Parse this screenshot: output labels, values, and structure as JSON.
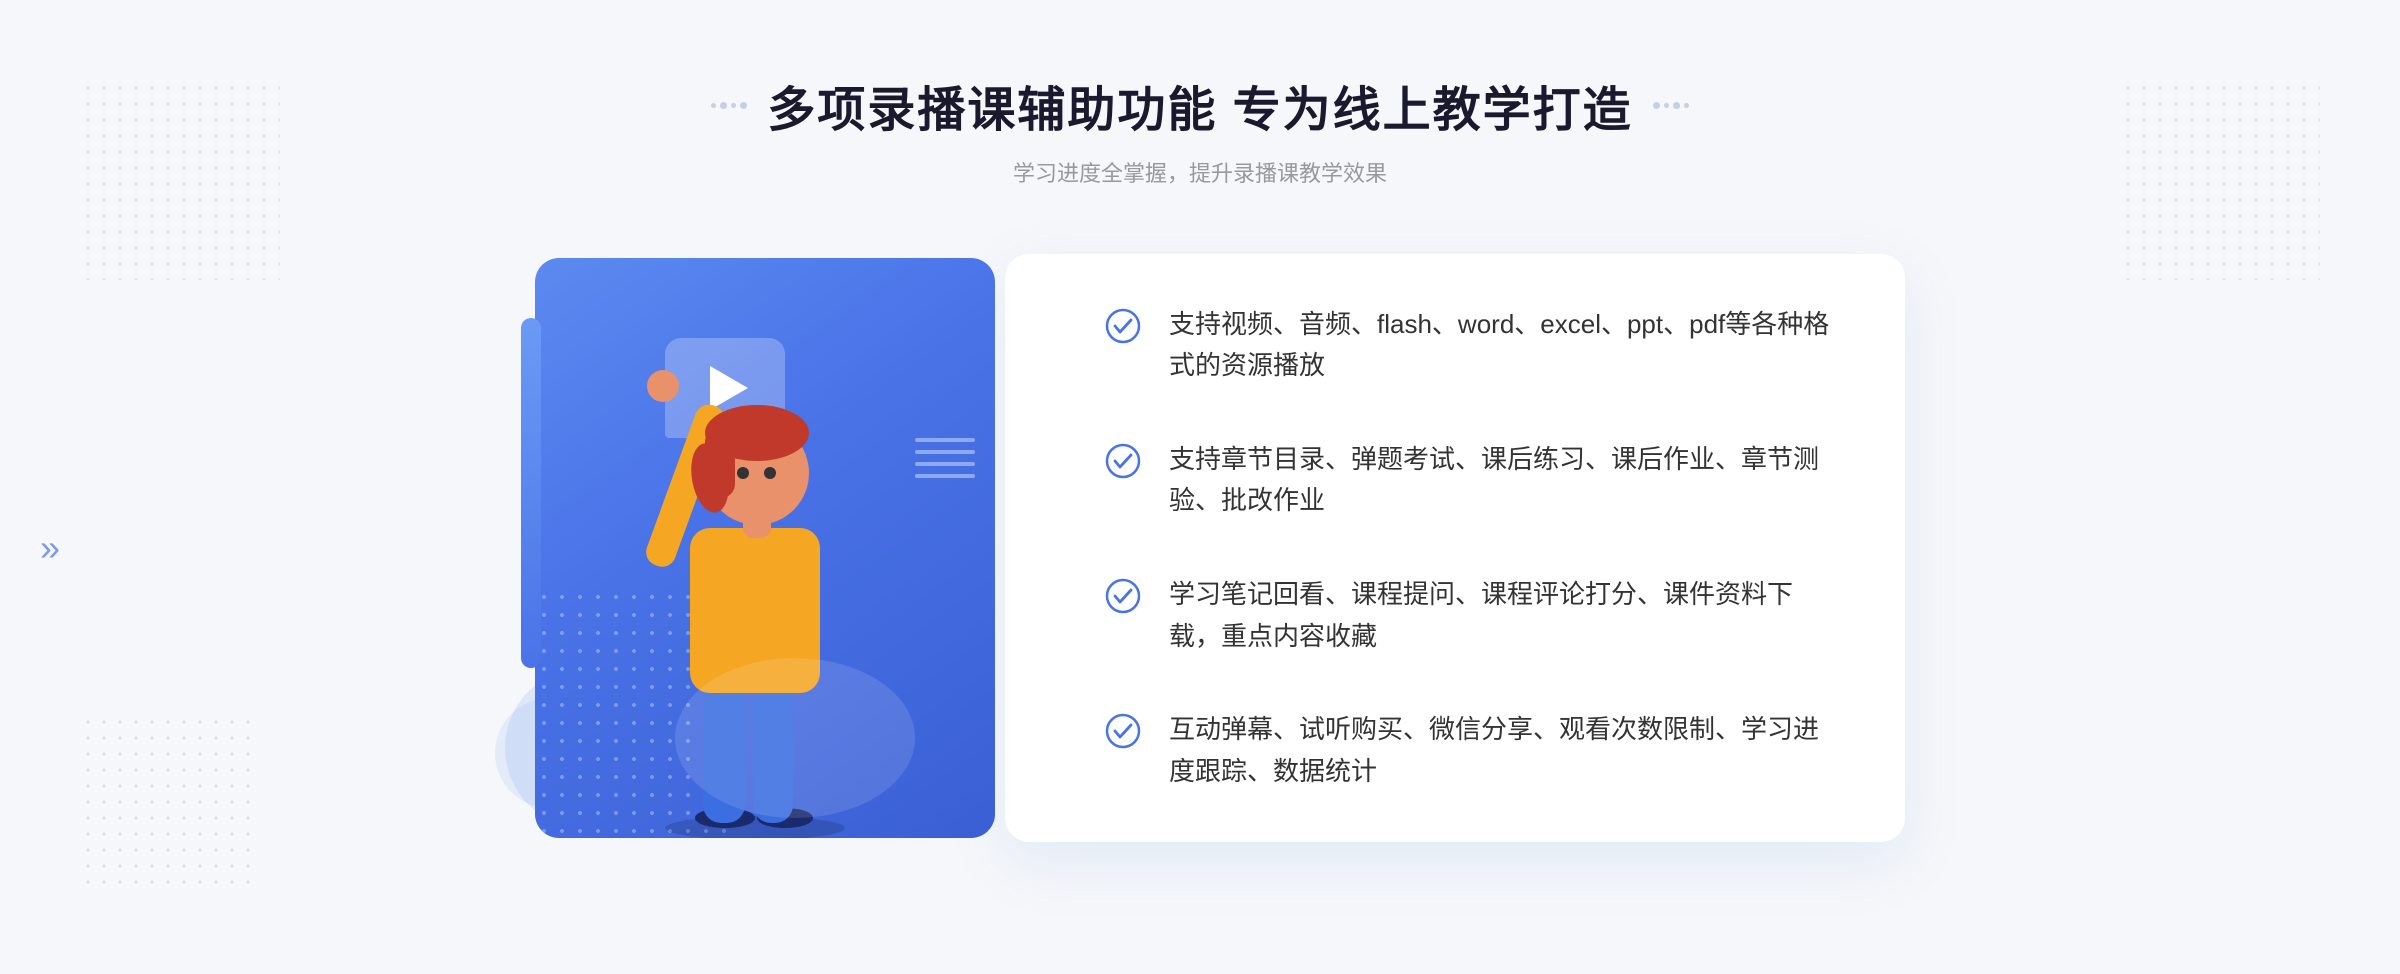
{
  "header": {
    "title": "多项录播课辅助功能 专为线上教学打造",
    "subtitle": "学习进度全掌握，提升录播课教学效果"
  },
  "features": [
    {
      "id": "feature-1",
      "text": "支持视频、音频、flash、word、excel、ppt、pdf等各种格式的资源播放"
    },
    {
      "id": "feature-2",
      "text": "支持章节目录、弹题考试、课后练习、课后作业、章节测验、批改作业"
    },
    {
      "id": "feature-3",
      "text": "学习笔记回看、课程提问、课程评论打分、课件资料下载，重点内容收藏"
    },
    {
      "id": "feature-4",
      "text": "互动弹幕、试听购买、微信分享、观看次数限制、学习进度跟踪、数据统计"
    }
  ],
  "decorations": {
    "left_arrow": "»",
    "check_color": "#4a73e8"
  }
}
